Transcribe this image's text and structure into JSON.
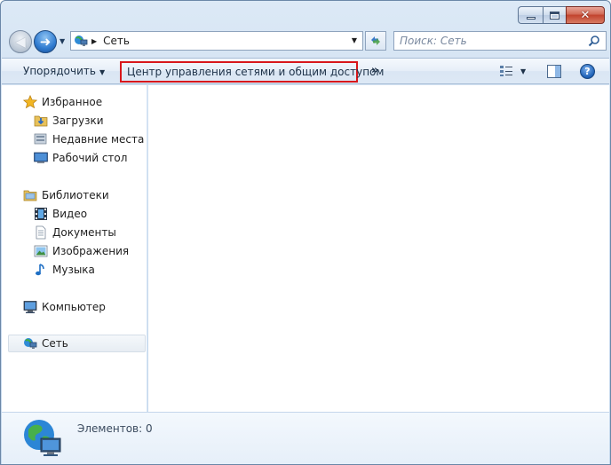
{
  "window": {
    "title": "Сеть"
  },
  "address": {
    "location": "Сеть"
  },
  "search": {
    "placeholder": "Поиск: Сеть"
  },
  "command_bar": {
    "organize": "Упорядочить",
    "network_center": "Центр управления сетями и общим доступом",
    "more": "»"
  },
  "sidebar": {
    "favorites": {
      "label": "Избранное",
      "items": [
        {
          "label": "Загрузки",
          "icon": "downloads-folder-icon"
        },
        {
          "label": "Недавние места",
          "icon": "recent-places-icon"
        },
        {
          "label": "Рабочий стол",
          "icon": "desktop-icon"
        }
      ]
    },
    "libraries": {
      "label": "Библиотеки",
      "items": [
        {
          "label": "Видео",
          "icon": "video-icon"
        },
        {
          "label": "Документы",
          "icon": "documents-icon"
        },
        {
          "label": "Изображения",
          "icon": "pictures-icon"
        },
        {
          "label": "Музыка",
          "icon": "music-icon"
        }
      ]
    },
    "computer": {
      "label": "Компьютер"
    },
    "network": {
      "label": "Сеть"
    }
  },
  "details": {
    "items_count": "Элементов: 0"
  },
  "colors": {
    "accent": "#2f7bd0",
    "highlight_border": "#d8171b",
    "close_button": "#c2432d"
  }
}
